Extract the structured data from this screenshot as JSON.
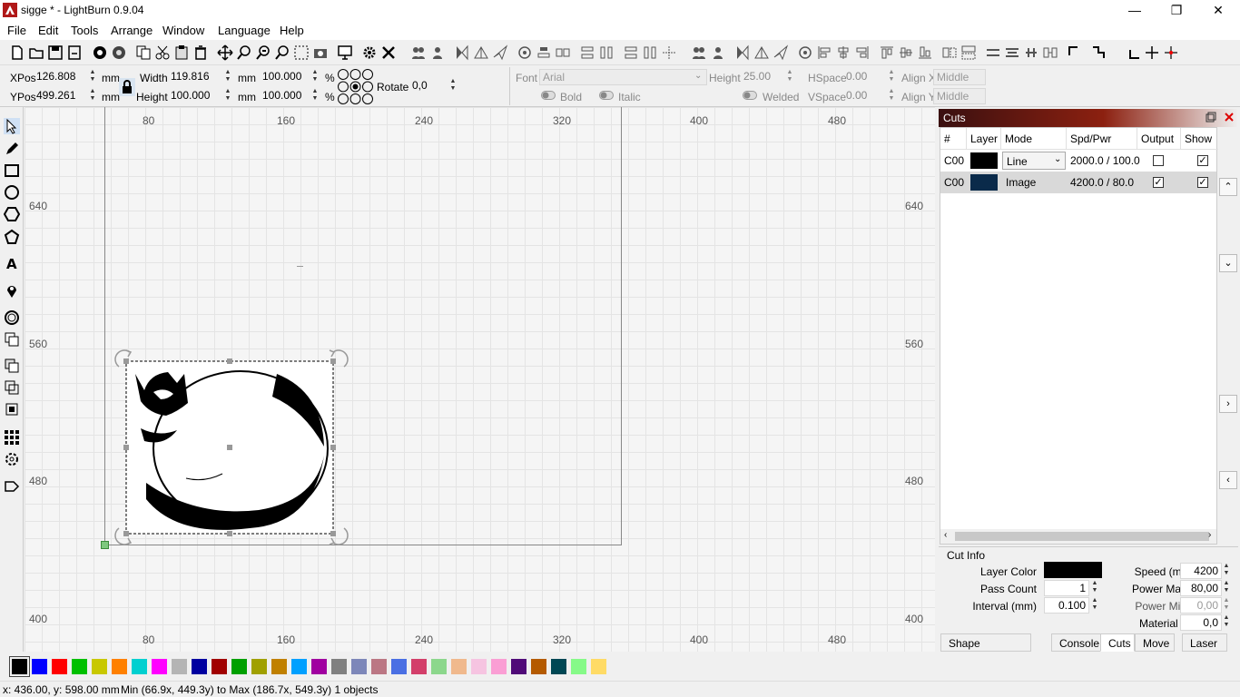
{
  "window": {
    "title": "sigge * - LightBurn 0.9.04",
    "minimize_glyph": "—",
    "maximize_glyph": "❐",
    "close_glyph": "✕"
  },
  "menu": [
    "File",
    "Edit",
    "Tools",
    "Arrange",
    "Window",
    "Language",
    "Help"
  ],
  "toolbar_icons": [
    "new-file-icon",
    "open-file-icon",
    "save-icon",
    "save-as-icon",
    "import-icon",
    "export-icon",
    "copy-icon",
    "cut-icon",
    "paste-icon",
    "delete-icon",
    "move-icon",
    "zoom-in-icon",
    "zoom-out-icon",
    "zoom-fit-icon",
    "select-frame-icon",
    "camera-icon",
    "monitor-icon",
    "settings-icon",
    "tools-icon",
    "group-icon",
    "ungroup-icon",
    "mirror-h-icon",
    "mirror-v-icon",
    "rotate-icon",
    "align-center-icon",
    "align-left-icon",
    "align-right-icon",
    "align-top-icon",
    "align-bottom-icon",
    "distribute-h-icon",
    "distribute-v-icon",
    "cross-icon"
  ],
  "numeric": {
    "xpos_label": "XPos",
    "xpos_value": "126.808",
    "xpos_unit": "mm",
    "ypos_label": "YPos",
    "ypos_value": "499.261",
    "ypos_unit": "mm",
    "width_label": "Width",
    "width_value": "119.816",
    "width_unit": "mm",
    "height_label": "Height",
    "height_value": "100.000",
    "height_unit": "mm",
    "scale_w": "100.000",
    "scale_h": "100.000",
    "percent": "%",
    "rotate_label": "Rotate",
    "rotate_value": "0,0"
  },
  "text_tools": {
    "font_label": "Font",
    "font_value": "Arial",
    "height_label": "Height",
    "height_value": "25.00",
    "hspace_label": "HSpace",
    "hspace_value": "0.00",
    "vspace_label": "VSpace",
    "vspace_value": "0.00",
    "alignx_label": "Align X",
    "alignx_value": "Middle",
    "aligny_label": "Align Y",
    "aligny_value": "Middle",
    "bold_label": "Bold",
    "italic_label": "Italic",
    "welded_label": "Welded"
  },
  "rulers": {
    "top": [
      "80",
      "160",
      "240",
      "320",
      "400",
      "480"
    ],
    "left": [
      "640",
      "560",
      "480",
      "400"
    ]
  },
  "cuts": {
    "title": "Cuts",
    "headers": [
      "#",
      "Layer",
      "Mode",
      "Spd/Pwr",
      "Output",
      "Show"
    ],
    "rows": [
      {
        "id": "C00",
        "color": "#000000",
        "mode": "Line",
        "spdpwr": "2000.0 / 100.0",
        "output": false,
        "show": true
      },
      {
        "id": "C00",
        "color": "#0a2a4a",
        "mode": "Image",
        "spdpwr": "4200.0 / 80.0",
        "output": true,
        "show": true
      }
    ],
    "side_buttons": [
      "⌃",
      "⌄",
      "›",
      "‹"
    ]
  },
  "cut_info": {
    "title": "Cut Info",
    "layer_color_label": "Layer Color",
    "layer_color": "#000000",
    "pass_count_label": "Pass Count",
    "pass_count": "1",
    "interval_label": "Interval (mm)",
    "interval": "0.100",
    "speed_label": "Speed (mm/m)",
    "speed": "4200",
    "power_max_label": "Power Max (%)",
    "power_max": "80,00",
    "power_min_label": "Power Min (%)",
    "power_min": "0,00",
    "material_label": "Material (mm)",
    "material": "0,0"
  },
  "bottom_tabs": [
    "Shape Properties",
    "Console",
    "Cuts",
    "Move",
    "Laser"
  ],
  "palette": [
    "#000000",
    "#0000ff",
    "#ff0000",
    "#00c000",
    "#c8c800",
    "#ff8000",
    "#00d0d0",
    "#ff00ff",
    "#b4b4b4",
    "#0000a0",
    "#a00000",
    "#00a000",
    "#a0a000",
    "#c08000",
    "#00a0ff",
    "#a000a0",
    "#808080",
    "#7d87b9",
    "#bb7784",
    "#4a6fe3",
    "#d33f6a",
    "#8cd78c",
    "#f0b98d",
    "#f6c4e1",
    "#fa9ed4",
    "#500a78",
    "#b45a00",
    "#004754",
    "#86fa88",
    "#ffdb66"
  ],
  "status": {
    "coords": "x: 436.00, y: 598.00 mm",
    "extent": "Min (66.9x, 449.3y) to Max (186.7x, 549.3y)  1 objects"
  }
}
